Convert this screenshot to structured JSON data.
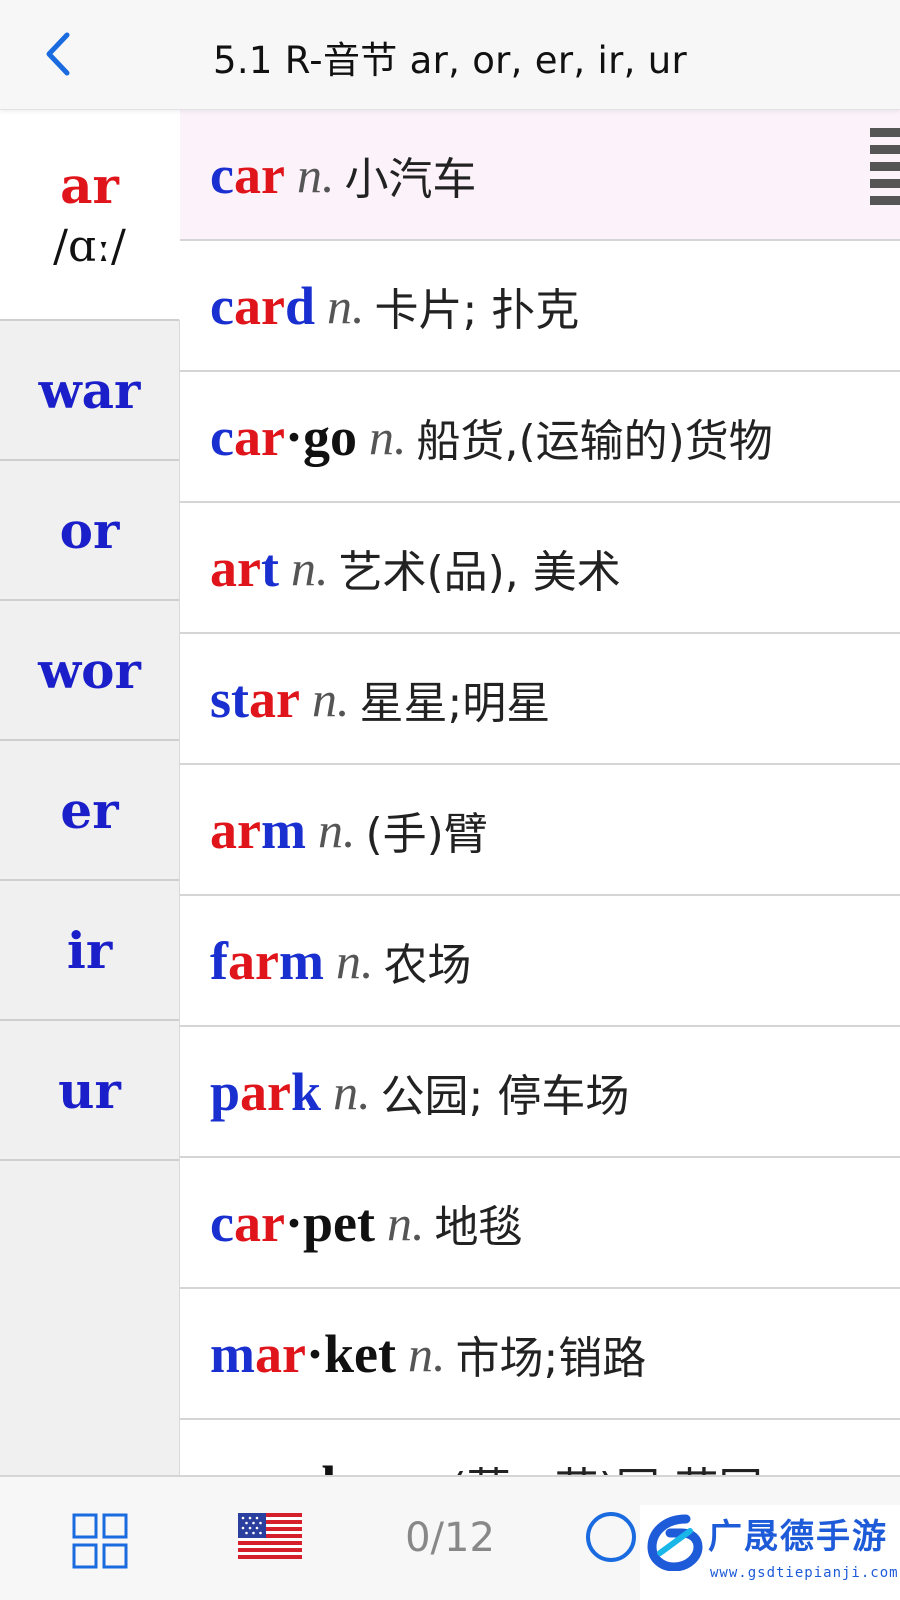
{
  "header": {
    "title": "5.1 R-音节 ar, or, er, ir, ur",
    "back_icon": "chevron-left-icon"
  },
  "sidebar": {
    "items": [
      {
        "label": "ar",
        "ipa": "/ɑː/",
        "active": true
      },
      {
        "label": "war"
      },
      {
        "label": "or"
      },
      {
        "label": "wor"
      },
      {
        "label": "er"
      },
      {
        "label": "ir"
      },
      {
        "label": "ur"
      }
    ]
  },
  "words": [
    {
      "parts": [
        {
          "t": "c",
          "c": "blue"
        },
        {
          "t": "ar",
          "c": "red"
        }
      ],
      "pos": "n.",
      "meaning": "小汽车",
      "selected": true
    },
    {
      "parts": [
        {
          "t": "c",
          "c": "blue"
        },
        {
          "t": "ar",
          "c": "red"
        },
        {
          "t": "d",
          "c": "blue"
        }
      ],
      "pos": "n.",
      "meaning": "卡片; 扑克"
    },
    {
      "parts": [
        {
          "t": "c",
          "c": "blue"
        },
        {
          "t": "ar",
          "c": "red"
        },
        {
          "t": "·go",
          "c": "black"
        }
      ],
      "pos": "n.",
      "meaning": "船货,(运输的)货物"
    },
    {
      "parts": [
        {
          "t": "ar",
          "c": "red"
        },
        {
          "t": "t",
          "c": "blue"
        }
      ],
      "pos": "n.",
      "meaning": "艺术(品), 美术"
    },
    {
      "parts": [
        {
          "t": "st",
          "c": "blue"
        },
        {
          "t": "ar",
          "c": "red"
        }
      ],
      "pos": "n.",
      "meaning": "星星;明星"
    },
    {
      "parts": [
        {
          "t": "ar",
          "c": "red"
        },
        {
          "t": "m",
          "c": "blue"
        }
      ],
      "pos": "n.",
      "meaning": "(手)臂"
    },
    {
      "parts": [
        {
          "t": "f",
          "c": "blue"
        },
        {
          "t": "ar",
          "c": "red"
        },
        {
          "t": "m",
          "c": "blue"
        }
      ],
      "pos": "n.",
      "meaning": "农场"
    },
    {
      "parts": [
        {
          "t": "p",
          "c": "blue"
        },
        {
          "t": "ar",
          "c": "red"
        },
        {
          "t": "k",
          "c": "blue"
        }
      ],
      "pos": "n.",
      "meaning": "公园; 停车场"
    },
    {
      "parts": [
        {
          "t": "c",
          "c": "blue"
        },
        {
          "t": "ar",
          "c": "red"
        },
        {
          "t": "·pet",
          "c": "black"
        }
      ],
      "pos": "n.",
      "meaning": "地毯"
    },
    {
      "parts": [
        {
          "t": "m",
          "c": "blue"
        },
        {
          "t": "ar",
          "c": "red"
        },
        {
          "t": "·ket",
          "c": "black"
        }
      ],
      "pos": "n.",
      "meaning": "市场;销路"
    },
    {
      "parts": [
        {
          "t": "g",
          "c": "blue"
        },
        {
          "t": "ar",
          "c": "red"
        },
        {
          "t": "·den",
          "c": "black"
        }
      ],
      "pos": "n.",
      "meaning": "(蔬、花)园;花园"
    }
  ],
  "bottombar": {
    "grid_icon": "grid-icon",
    "flag_icon": "us-flag-icon",
    "page_count": "0/12",
    "circle_icon": "circle-icon"
  },
  "watermark": {
    "text": "广晟德手游",
    "sub": "www.gsdtiepianji.com"
  },
  "colors": {
    "blue": "#1a2fd0",
    "red": "#e0141b",
    "accent": "#1a6be0"
  }
}
